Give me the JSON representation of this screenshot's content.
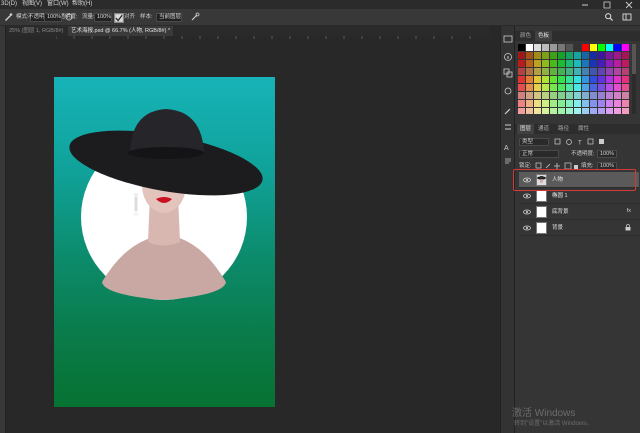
{
  "menubar": {
    "items": [
      "3D(D)",
      "视图(V)",
      "窗口(W)",
      "帮助(H)"
    ]
  },
  "options_bar": {
    "mode_label": "模式:",
    "opacity_label": "不透明度:",
    "opacity_value": "100%",
    "flow_label": "流量:",
    "flow_value": "100%",
    "align_label": "对齐",
    "sample_label": "样本:",
    "sample_value": "当前图层"
  },
  "tabs": [
    {
      "label": "25% (图层 1, RGB/8#)",
      "active": false
    },
    {
      "label": "艺术海报.psd @ 66.7% (人物, RGB/8#) *",
      "active": true
    }
  ],
  "colors": {
    "doc_top": "#17b3b8",
    "doc_bottom": "#067331",
    "highlight": "#d23a3a",
    "panel_bg": "#353535"
  },
  "swatches_panel": {
    "tabs": [
      "颜色",
      "色板"
    ],
    "active_tab": 1
  },
  "layers_panel": {
    "tabs": [
      "图层",
      "通道",
      "路径",
      "属性"
    ],
    "active_tab": 0,
    "kind_filter": "类型",
    "blend_mode": "正常",
    "opacity_label": "不透明度:",
    "opacity_value": "100%",
    "lock_label": "锁定:",
    "fill_label": "填充:",
    "fill_value": "100%",
    "layers": [
      {
        "name": "人物",
        "selected": true,
        "fx": ""
      },
      {
        "name": "椭圆 1",
        "selected": false,
        "fx": ""
      },
      {
        "name": "底背景",
        "selected": false,
        "fx": "fx"
      },
      {
        "name": "背景",
        "selected": false,
        "fx": ""
      }
    ]
  },
  "watermark": {
    "line1": "激活 Windows",
    "line2": "转到\"设置\"以激活 Windows。"
  }
}
